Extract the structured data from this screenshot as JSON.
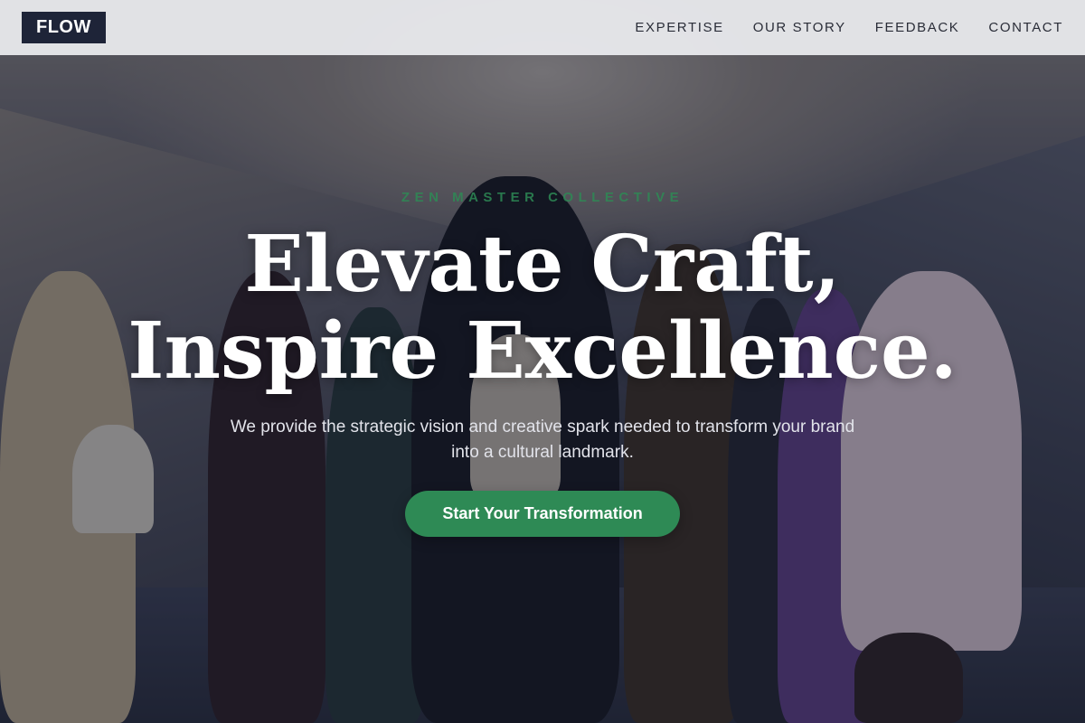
{
  "navbar": {
    "logo": "FLOW",
    "links": [
      "EXPERTISE",
      "OUR STORY",
      "FEEDBACK",
      "CONTACT"
    ]
  },
  "hero": {
    "eyebrow": "ZEN MASTER COLLECTIVE",
    "headline_line1": "Elevate Craft,",
    "headline_line2": "Inspire Excellence.",
    "subtext": "We provide the strategic vision and creative spark needed to transform your brand into a cultural landmark.",
    "cta_label": "Start Your Transformation"
  },
  "colors": {
    "accent": "#2e8a55",
    "logo_bg": "#1e2438",
    "nav_bg": "#ecedf0"
  }
}
